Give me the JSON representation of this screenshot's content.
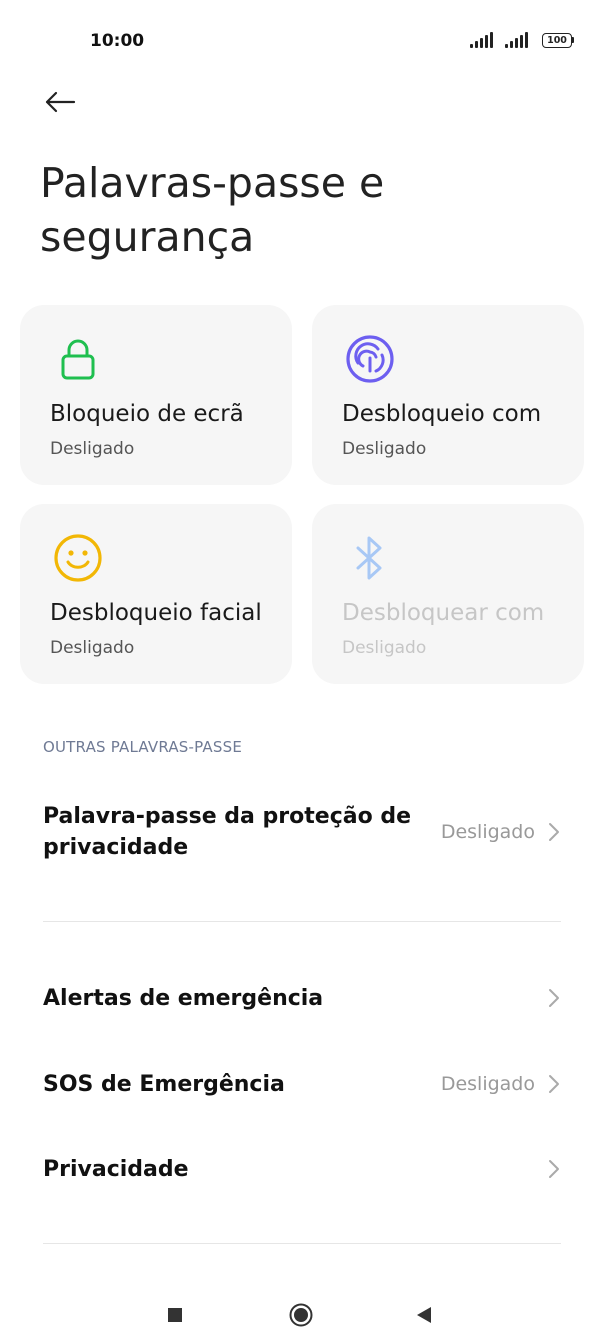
{
  "status_bar": {
    "time": "10:00",
    "battery": "100"
  },
  "header": {
    "back_icon": "arrow-left-icon",
    "title": "Palavras-passe e segurança"
  },
  "tiles": [
    {
      "title": "Bloqueio de ecrã",
      "status": "Desligado",
      "icon": "lock-icon",
      "color": "#1fbf4f",
      "enabled": true
    },
    {
      "title": "Desbloqueio com",
      "status": "Desligado",
      "icon": "fingerprint-icon",
      "color": "#6d5ff0",
      "enabled": true
    },
    {
      "title": "Desbloqueio facial",
      "status": "Desligado",
      "icon": "smiley-face-icon",
      "color": "#f2b705",
      "enabled": true
    },
    {
      "title": "Desbloquear com",
      "status": "Desligado",
      "icon": "bluetooth-icon",
      "color": "#a8c8f5",
      "enabled": false
    }
  ],
  "section": {
    "header": "OUTRAS PALAVRAS-PASSE"
  },
  "rows": [
    {
      "label": "Palavra-passe da proteção de privacidade",
      "value": "Desligado"
    },
    {
      "label": "Alertas de emergência",
      "value": ""
    },
    {
      "label": "SOS de Emergência",
      "value": "Desligado"
    },
    {
      "label": "Privacidade",
      "value": ""
    }
  ],
  "nav_bar": {
    "items": [
      "recents-square-icon",
      "home-circle-icon",
      "back-triangle-icon"
    ]
  }
}
